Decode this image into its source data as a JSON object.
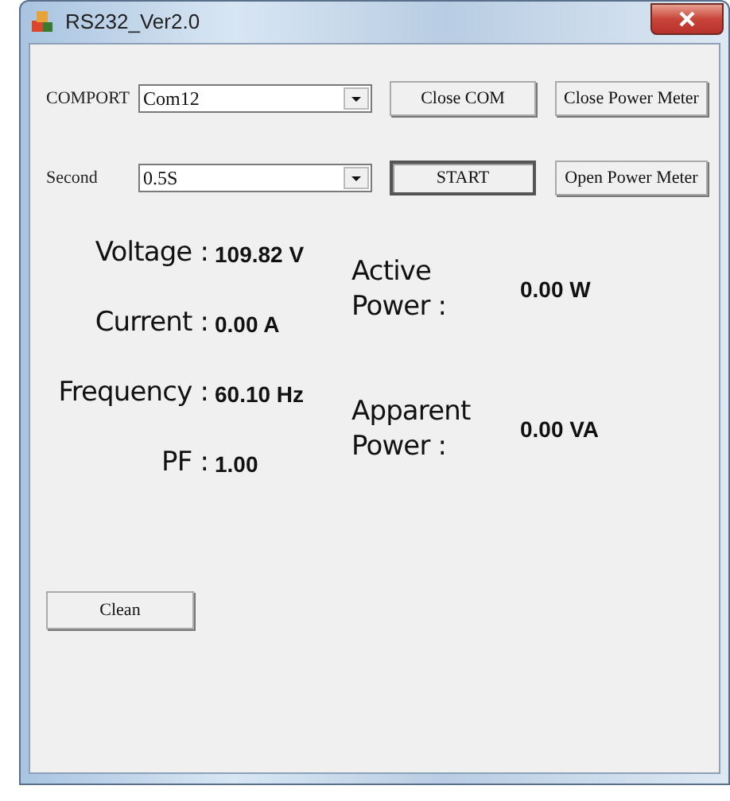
{
  "window": {
    "title": "RS232_Ver2.0"
  },
  "controls": [
    {
      "label": "COMPORT",
      "value": "Com12",
      "button": {
        "label": "Close COM",
        "pressed": false
      },
      "side_button": "Close Power Meter"
    },
    {
      "label": "Second",
      "value": "0.5S",
      "button": {
        "label": "START",
        "pressed": true
      },
      "side_button": "Open Power Meter"
    }
  ],
  "readings": [
    {
      "label": "Voltage :",
      "value": "109.82 V"
    },
    {
      "label": "Current :",
      "value": "0.00 A"
    },
    {
      "label": "Frequency :",
      "value": "60.10 Hz"
    },
    {
      "label": "PF :",
      "value": "1.00"
    }
  ],
  "power": [
    {
      "label_line_1": "Active",
      "label_line_2": "Power :",
      "value": "0.00 W"
    },
    {
      "label_line_1": "Apparent",
      "label_line_2": "Power :",
      "value": "0.00 VA"
    }
  ],
  "clean_button": "Clean"
}
